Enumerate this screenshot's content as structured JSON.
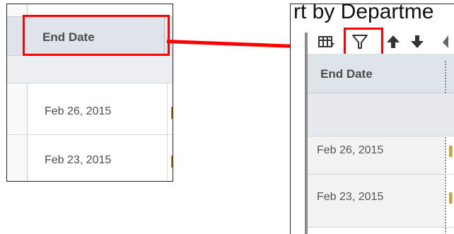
{
  "left_panel": {
    "header_label": "End Date",
    "rows": [
      "Feb 26, 2015",
      "Feb 23, 2015"
    ]
  },
  "right_panel": {
    "title_fragment": "rt by Departme",
    "header_label": "End Date",
    "rows": [
      "Feb 26, 2015",
      "Feb 23, 2015"
    ],
    "toolbar": [
      {
        "icon": "table-columns-icon"
      },
      {
        "icon": "filter-icon"
      },
      {
        "icon": "arrow-up-icon"
      },
      {
        "icon": "arrow-down-icon"
      }
    ]
  },
  "colors": {
    "highlight": "#ff0000",
    "header_bg": "#dfe3ea",
    "text": "#4b4b4b"
  }
}
